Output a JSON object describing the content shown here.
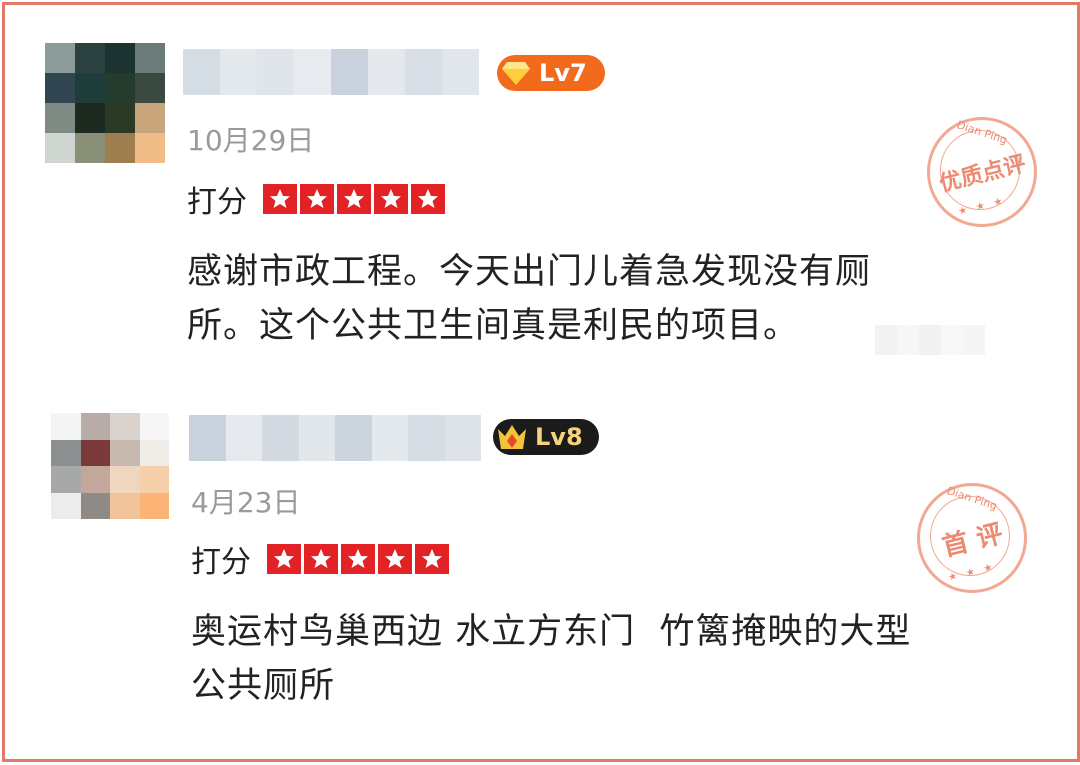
{
  "reviews": [
    {
      "level": "Lv7",
      "date": "10月29日",
      "rating_label": "打分",
      "stars": 5,
      "content_lines": [
        "感谢市政工程。今天出门儿着急发现没有厕",
        "所。这个公共卫生间真是利民的项目。"
      ],
      "stamp": {
        "arc": "Dian Ping",
        "text": "优质点评",
        "dots": "★ ★ ★"
      }
    },
    {
      "level": "Lv8",
      "date": "4月23日",
      "rating_label": "打分",
      "stars": 5,
      "content_lines": [
        "奥运村鸟巢西边 水立方东门  竹篱掩映的大型",
        "公共厕所"
      ],
      "stamp": {
        "arc": "Dian Ping",
        "text": "首 评",
        "dots": "★ ★ ★"
      }
    }
  ],
  "colors": {
    "frame_border": "#e07a66",
    "star_red": "#e32226",
    "lv7_orange": "#f26a1b",
    "lv8_black": "#1b1b1b",
    "stamp": "#e9775b"
  }
}
